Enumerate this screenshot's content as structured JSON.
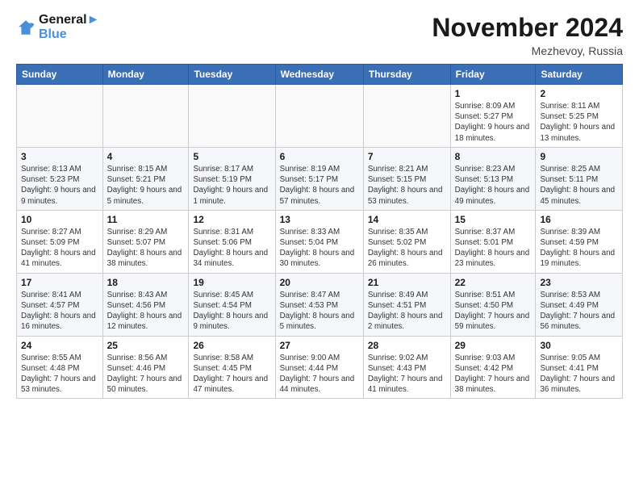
{
  "logo": {
    "line1": "General",
    "line2": "Blue"
  },
  "title": "November 2024",
  "subtitle": "Mezhevoy, Russia",
  "weekdays": [
    "Sunday",
    "Monday",
    "Tuesday",
    "Wednesday",
    "Thursday",
    "Friday",
    "Saturday"
  ],
  "weeks": [
    [
      {
        "day": "",
        "info": ""
      },
      {
        "day": "",
        "info": ""
      },
      {
        "day": "",
        "info": ""
      },
      {
        "day": "",
        "info": ""
      },
      {
        "day": "",
        "info": ""
      },
      {
        "day": "1",
        "info": "Sunrise: 8:09 AM\nSunset: 5:27 PM\nDaylight: 9 hours and 18 minutes."
      },
      {
        "day": "2",
        "info": "Sunrise: 8:11 AM\nSunset: 5:25 PM\nDaylight: 9 hours and 13 minutes."
      }
    ],
    [
      {
        "day": "3",
        "info": "Sunrise: 8:13 AM\nSunset: 5:23 PM\nDaylight: 9 hours and 9 minutes."
      },
      {
        "day": "4",
        "info": "Sunrise: 8:15 AM\nSunset: 5:21 PM\nDaylight: 9 hours and 5 minutes."
      },
      {
        "day": "5",
        "info": "Sunrise: 8:17 AM\nSunset: 5:19 PM\nDaylight: 9 hours and 1 minute."
      },
      {
        "day": "6",
        "info": "Sunrise: 8:19 AM\nSunset: 5:17 PM\nDaylight: 8 hours and 57 minutes."
      },
      {
        "day": "7",
        "info": "Sunrise: 8:21 AM\nSunset: 5:15 PM\nDaylight: 8 hours and 53 minutes."
      },
      {
        "day": "8",
        "info": "Sunrise: 8:23 AM\nSunset: 5:13 PM\nDaylight: 8 hours and 49 minutes."
      },
      {
        "day": "9",
        "info": "Sunrise: 8:25 AM\nSunset: 5:11 PM\nDaylight: 8 hours and 45 minutes."
      }
    ],
    [
      {
        "day": "10",
        "info": "Sunrise: 8:27 AM\nSunset: 5:09 PM\nDaylight: 8 hours and 41 minutes."
      },
      {
        "day": "11",
        "info": "Sunrise: 8:29 AM\nSunset: 5:07 PM\nDaylight: 8 hours and 38 minutes."
      },
      {
        "day": "12",
        "info": "Sunrise: 8:31 AM\nSunset: 5:06 PM\nDaylight: 8 hours and 34 minutes."
      },
      {
        "day": "13",
        "info": "Sunrise: 8:33 AM\nSunset: 5:04 PM\nDaylight: 8 hours and 30 minutes."
      },
      {
        "day": "14",
        "info": "Sunrise: 8:35 AM\nSunset: 5:02 PM\nDaylight: 8 hours and 26 minutes."
      },
      {
        "day": "15",
        "info": "Sunrise: 8:37 AM\nSunset: 5:01 PM\nDaylight: 8 hours and 23 minutes."
      },
      {
        "day": "16",
        "info": "Sunrise: 8:39 AM\nSunset: 4:59 PM\nDaylight: 8 hours and 19 minutes."
      }
    ],
    [
      {
        "day": "17",
        "info": "Sunrise: 8:41 AM\nSunset: 4:57 PM\nDaylight: 8 hours and 16 minutes."
      },
      {
        "day": "18",
        "info": "Sunrise: 8:43 AM\nSunset: 4:56 PM\nDaylight: 8 hours and 12 minutes."
      },
      {
        "day": "19",
        "info": "Sunrise: 8:45 AM\nSunset: 4:54 PM\nDaylight: 8 hours and 9 minutes."
      },
      {
        "day": "20",
        "info": "Sunrise: 8:47 AM\nSunset: 4:53 PM\nDaylight: 8 hours and 5 minutes."
      },
      {
        "day": "21",
        "info": "Sunrise: 8:49 AM\nSunset: 4:51 PM\nDaylight: 8 hours and 2 minutes."
      },
      {
        "day": "22",
        "info": "Sunrise: 8:51 AM\nSunset: 4:50 PM\nDaylight: 7 hours and 59 minutes."
      },
      {
        "day": "23",
        "info": "Sunrise: 8:53 AM\nSunset: 4:49 PM\nDaylight: 7 hours and 56 minutes."
      }
    ],
    [
      {
        "day": "24",
        "info": "Sunrise: 8:55 AM\nSunset: 4:48 PM\nDaylight: 7 hours and 53 minutes."
      },
      {
        "day": "25",
        "info": "Sunrise: 8:56 AM\nSunset: 4:46 PM\nDaylight: 7 hours and 50 minutes."
      },
      {
        "day": "26",
        "info": "Sunrise: 8:58 AM\nSunset: 4:45 PM\nDaylight: 7 hours and 47 minutes."
      },
      {
        "day": "27",
        "info": "Sunrise: 9:00 AM\nSunset: 4:44 PM\nDaylight: 7 hours and 44 minutes."
      },
      {
        "day": "28",
        "info": "Sunrise: 9:02 AM\nSunset: 4:43 PM\nDaylight: 7 hours and 41 minutes."
      },
      {
        "day": "29",
        "info": "Sunrise: 9:03 AM\nSunset: 4:42 PM\nDaylight: 7 hours and 38 minutes."
      },
      {
        "day": "30",
        "info": "Sunrise: 9:05 AM\nSunset: 4:41 PM\nDaylight: 7 hours and 36 minutes."
      }
    ]
  ]
}
